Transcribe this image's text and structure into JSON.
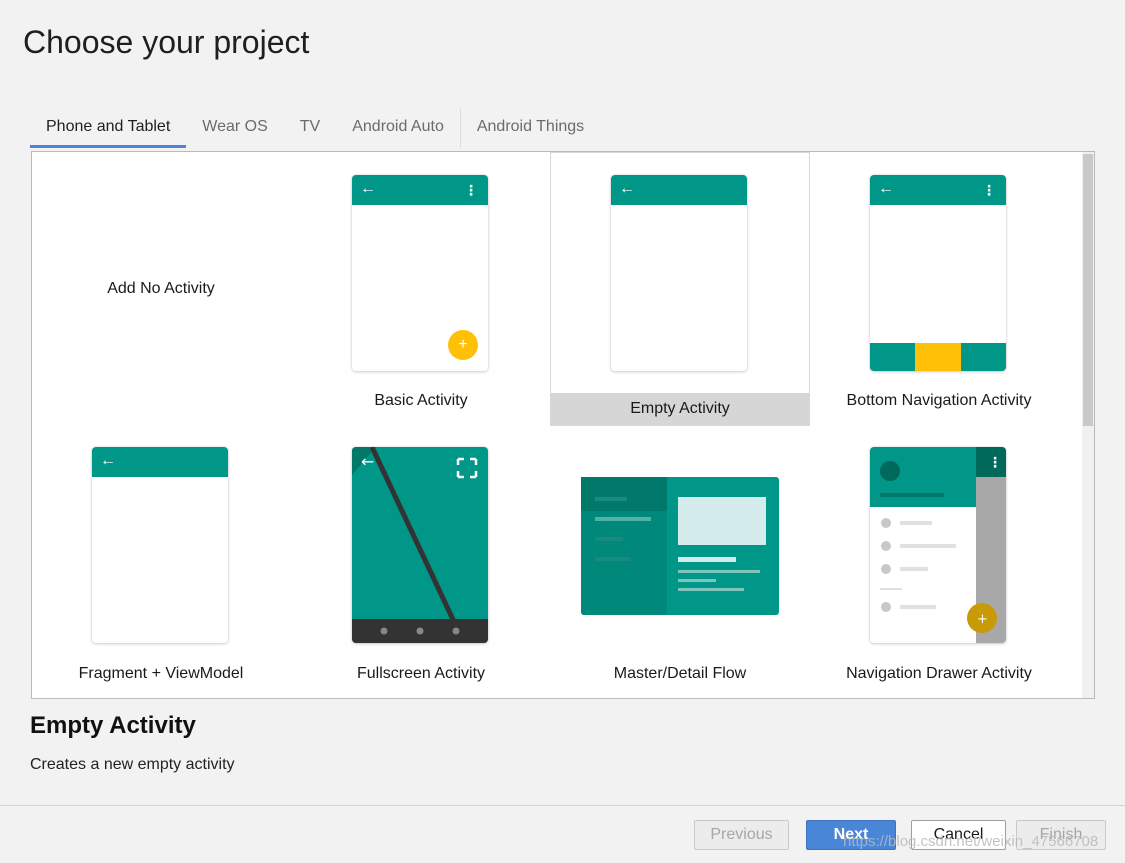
{
  "window": {
    "title": "Choose your project"
  },
  "tabs": [
    {
      "label": "Phone and Tablet",
      "active": true
    },
    {
      "label": "Wear OS",
      "active": false
    },
    {
      "label": "TV",
      "active": false
    },
    {
      "label": "Android Auto",
      "active": false
    },
    {
      "label": "Android Things",
      "active": false
    }
  ],
  "templates": [
    {
      "label": "Add No Activity"
    },
    {
      "label": "Basic Activity"
    },
    {
      "label": "Empty Activity",
      "selected": true
    },
    {
      "label": "Bottom Navigation Activity"
    },
    {
      "label": "Fragment + ViewModel"
    },
    {
      "label": "Fullscreen Activity"
    },
    {
      "label": "Master/Detail Flow"
    },
    {
      "label": "Navigation Drawer Activity"
    }
  ],
  "details": {
    "title": "Empty Activity",
    "description": "Creates a new empty activity"
  },
  "buttons": {
    "previous": "Previous",
    "next": "Next",
    "cancel": "Cancel",
    "finish": "Finish"
  },
  "watermark": "https://blog.csdn.net/weixin_47566708",
  "colors": {
    "primary": "#009688",
    "accent": "#ffc107",
    "selection": "#d6d6d6",
    "button_primary": "#4a86d8"
  }
}
